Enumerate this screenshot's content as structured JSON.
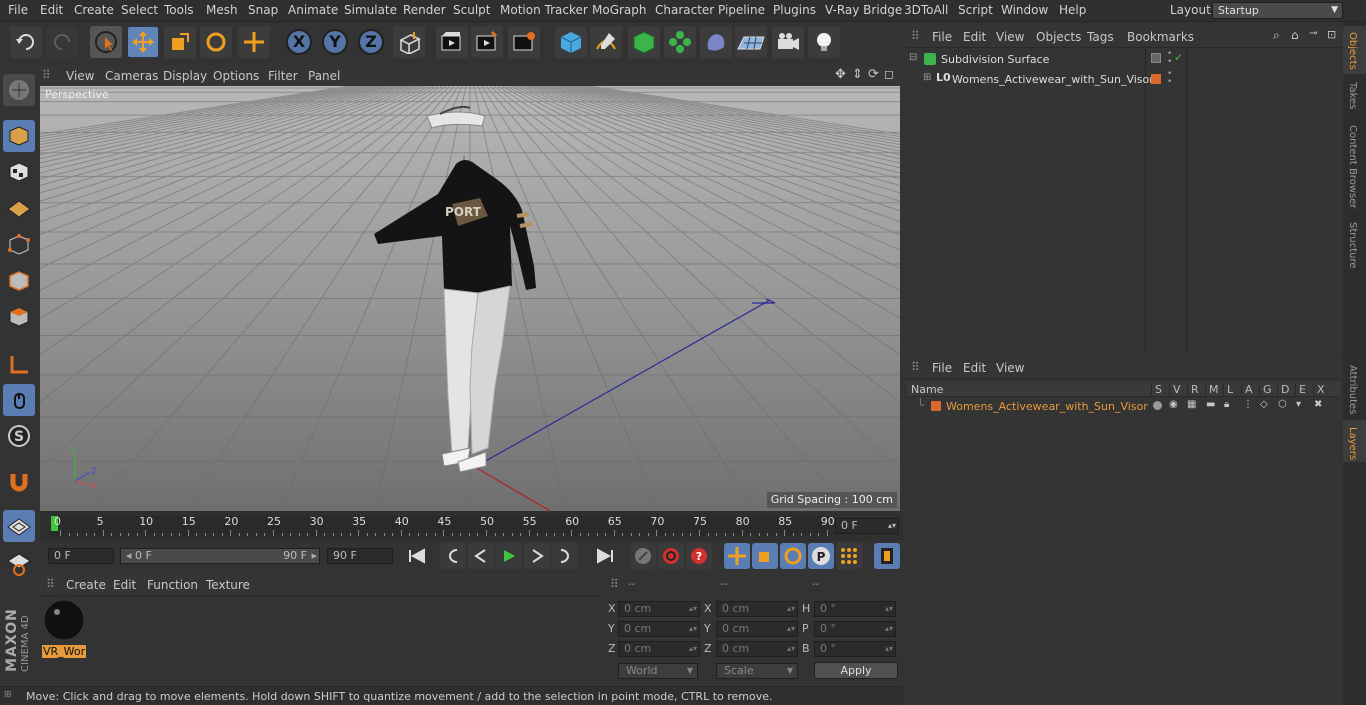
{
  "menubar": {
    "items": [
      "File",
      "Edit",
      "Create",
      "Select",
      "Tools",
      "Mesh",
      "Snap",
      "Animate",
      "Simulate",
      "Render",
      "Sculpt",
      "Motion Tracker",
      "MoGraph",
      "Character",
      "Pipeline",
      "Plugins",
      "V-Ray Bridge",
      "3DToAll",
      "Script",
      "Window",
      "Help"
    ],
    "layout_label": "Layout:",
    "layout_value": "Startup"
  },
  "toolbar": {
    "axis_x": "X",
    "axis_y": "Y",
    "axis_z": "Z"
  },
  "viewport": {
    "menu": [
      "View",
      "Cameras",
      "Display",
      "Options",
      "Filter",
      "Panel"
    ],
    "camera_label": "Perspective",
    "grid_spacing": "Grid Spacing : 100 cm",
    "sweater_text": "PORT"
  },
  "timeline": {
    "ticks": [
      "0",
      "5",
      "10",
      "15",
      "20",
      "25",
      "30",
      "35",
      "40",
      "45",
      "50",
      "55",
      "60",
      "65",
      "70",
      "75",
      "80",
      "85",
      "90"
    ],
    "current_frame": "0 F"
  },
  "controls": {
    "start_frame": "0 F",
    "range_start": "0 F",
    "range_end": "90 F",
    "end_frame": "90 F"
  },
  "material_panel": {
    "menu": [
      "Create",
      "Edit",
      "Function",
      "Texture"
    ],
    "material_name": "VR_Wor"
  },
  "attributes": {
    "headers": [
      "--",
      "--",
      "--"
    ],
    "rows": [
      {
        "a": "X",
        "av": "0 cm",
        "b": "X",
        "bv": "0 cm",
        "c": "H",
        "cv": "0 °"
      },
      {
        "a": "Y",
        "av": "0 cm",
        "b": "Y",
        "bv": "0 cm",
        "c": "P",
        "cv": "0 °"
      },
      {
        "a": "Z",
        "av": "0 cm",
        "b": "Z",
        "bv": "0 cm",
        "c": "B",
        "cv": "0 °"
      }
    ],
    "coord_mode": "World",
    "scale_mode": "Scale",
    "apply_label": "Apply"
  },
  "status": "Move: Click and drag to move elements. Hold down SHIFT to quantize movement / add to the selection in point mode, CTRL to remove.",
  "objects_panel": {
    "menu": [
      "File",
      "Edit",
      "View",
      "Objects",
      "Tags",
      "Bookmarks"
    ],
    "items": [
      "Subdivision Surface",
      "Womens_Activewear_with_Sun_Visor"
    ]
  },
  "layers_panel": {
    "menu": [
      "File",
      "Edit",
      "View"
    ],
    "name_header": "Name",
    "col_headers": [
      "S",
      "V",
      "R",
      "M",
      "L",
      "A",
      "G",
      "D",
      "E",
      "X"
    ],
    "layer_name": "Womens_Activewear_with_Sun_Visor"
  },
  "right_tabs": [
    "Objects",
    "Takes",
    "Content Browser",
    "Structure",
    "Attributes",
    "Layers"
  ],
  "branding": {
    "maxon": "MAXON",
    "product": "CINEMA 4D"
  },
  "colors": {
    "accent": "#5a7db3",
    "orange": "#e6a23c",
    "play_green": "#3ec43e"
  }
}
